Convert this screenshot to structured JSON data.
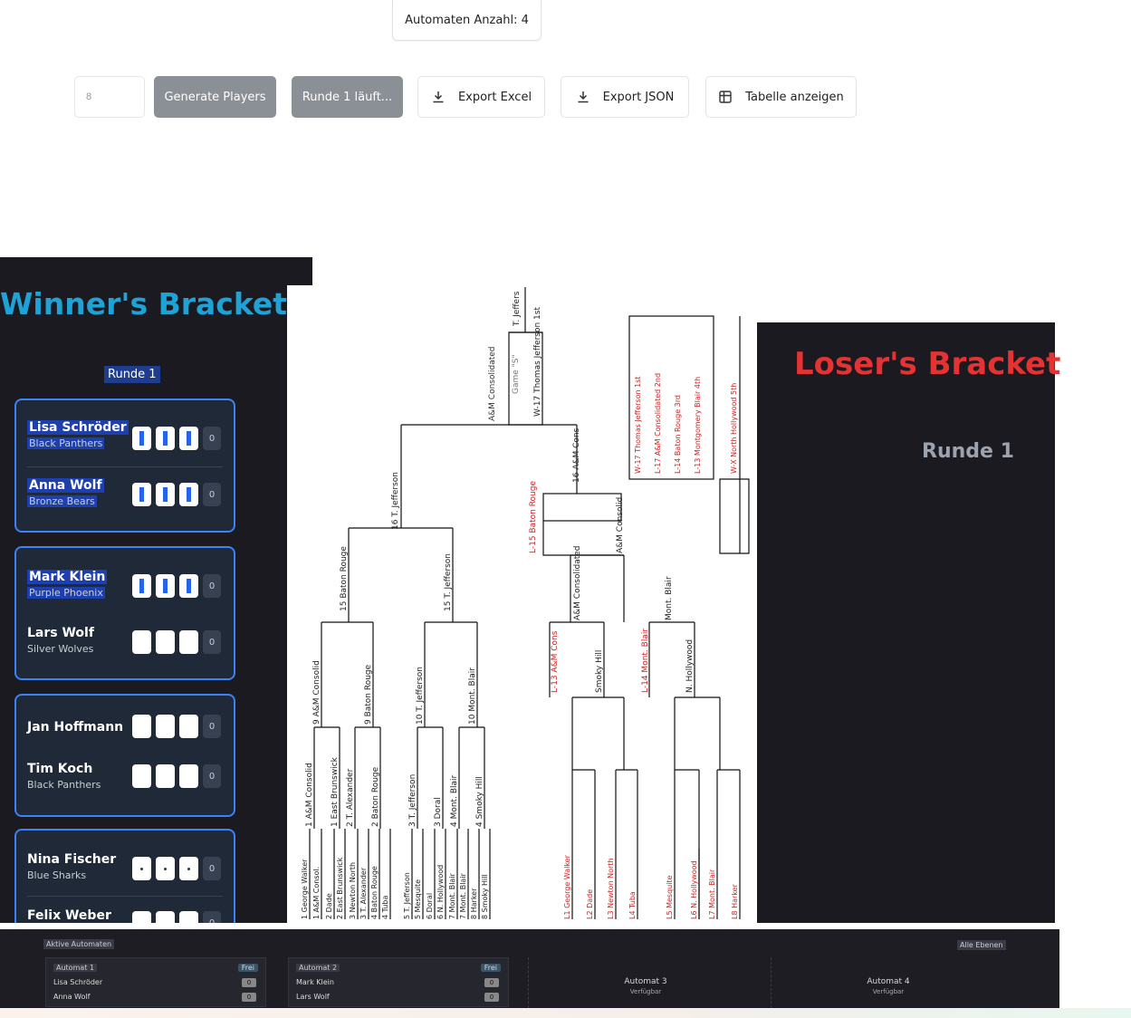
{
  "toolbar": {
    "counter_label": "Automaten Anzahl: 4",
    "players_input_value": "8",
    "generate_label": "Generate Players",
    "round_label": "Runde 1 läuft...",
    "export_excel_label": "Export Excel",
    "export_json_label": "Export JSON",
    "show_table_label": "Tabelle anzeigen"
  },
  "winners": {
    "title": "Winner's Bracket",
    "round": "Runde 1",
    "matches": [
      {
        "p1": {
          "name": "Lisa Schröder",
          "team": "Black Panthers",
          "total": "0"
        },
        "p2": {
          "name": "Anna Wolf",
          "team": "Bronze Bears",
          "total": "0"
        }
      },
      {
        "p1": {
          "name": "Mark Klein",
          "team": "Purple Phoenix",
          "total": "0"
        },
        "p2": {
          "name": "Lars Wolf",
          "team": "Silver Wolves",
          "total": "0"
        }
      },
      {
        "p1": {
          "name": "Jan Hoffmann",
          "team": "",
          "total": "0"
        },
        "p2": {
          "name": "Tim Koch",
          "team": "Black Panthers",
          "total": "0"
        }
      },
      {
        "p1": {
          "name": "Nina Fischer",
          "team": "Blue Sharks",
          "total": "0"
        },
        "p2": {
          "name": "Felix Weber",
          "team": "",
          "total": "0"
        }
      }
    ]
  },
  "losers": {
    "title": "Loser's Bracket",
    "round": "Runde 1"
  },
  "diagram": {
    "champion": "T. Jeffers",
    "final_game": "Game \"S\"",
    "results": [
      "W-17 Thomas Jefferson 1st",
      "L-17 A&M Consolidated 2nd",
      "L-14 Baton Rouge 3rd",
      "L-13 Montgomery Blair 4th",
      "W-X North Hollywood 5th"
    ],
    "first_round": [
      "1 George Walker",
      "1 A&M Consol.",
      "2 Dade",
      "2 East Brunswick",
      "3 Newton North",
      "3 T. Alexander",
      "4 Baton Rouge",
      "4 Tuba",
      "5 T. Jefferson",
      "5 Mesquite",
      "6 Doral",
      "6 N. Hollywood",
      "7 Mont. Blair",
      "7 Mont. Blair",
      "8 Harker",
      "8 Smoky Hill"
    ],
    "second_round": [
      "1 A&M Consolid",
      "1 East Brunswick",
      "2 T. Alexander",
      "2 Baton Rouge",
      "3 T. Jefferson",
      "3 Doral",
      "4 Mont. Blair",
      "4 Smoky Hill"
    ],
    "third_round": [
      "9 A&M Consolid",
      "9 Baton Rouge",
      "10 T. Jefferson",
      "10 Mont. Blair"
    ],
    "semis": [
      "15 Baton Rouge",
      "15 T. Jefferson"
    ],
    "wb_final": [
      "16 T. Jefferson",
      "16 A&M Cons"
    ],
    "lb_labels": [
      "A&M Consolidated",
      "L-13 A&M Cons",
      "Smoky Hill",
      "L-14 Mont. Blair",
      "N. Hollywood",
      "L-15 Baton Rouge",
      "A&M Consolid",
      "Mont. Blair"
    ],
    "lb_first": [
      "L1 George Walker",
      "L2 Dade",
      "L3 Newton North",
      "L4 Tuba",
      "L5 Mesquite",
      "L6 N. Hollywood",
      "L7 Mont. Blair",
      "L8 Harker"
    ]
  },
  "bottom": {
    "active_tab": "Aktive Automaten",
    "right_tab": "Alle Ebenen",
    "machines": [
      {
        "name": "Automat 1",
        "status": "Frei",
        "p1": "Lisa Schröder",
        "p2": "Anna Wolf",
        "s1": "0",
        "s2": "0"
      },
      {
        "name": "Automat 2",
        "status": "Frei",
        "p1": "Mark Klein",
        "p2": "Lars Wolf",
        "s1": "0",
        "s2": "0"
      },
      {
        "name": "Automat 3",
        "status": "Verfügbar"
      },
      {
        "name": "Automat 4",
        "status": "Verfügbar"
      }
    ]
  },
  "colors": {
    "accent": "#3b82f6",
    "winner_title": "#1fa3d6",
    "loser_title": "#e53232",
    "panel": "#1b1a21"
  }
}
